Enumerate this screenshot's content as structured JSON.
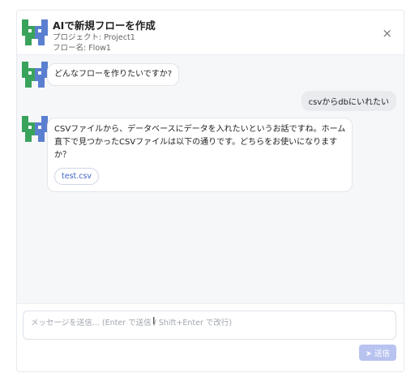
{
  "header": {
    "title": "AIで新規フローを作成",
    "project": "プロジェクト: Project1",
    "flow": "フロー名: Flow1",
    "close_label": "×"
  },
  "messages": [
    {
      "role": "assistant",
      "text": "どんなフローを作りたいですか?"
    },
    {
      "role": "user",
      "text": "csvからdbにいれたい"
    },
    {
      "role": "assistant",
      "text": "CSVファイルから、データベースにデータを入れたいというお話ですね。ホーム直下で見つかったCSVファイルは以下の通りです。どちらをお使いになりますか？",
      "file": "test.csv"
    }
  ],
  "input": {
    "placeholder": "メッセージを送信... (Enter で送信 / Shift+Enter で改行)",
    "value": ""
  },
  "send_button": {
    "label": "➤ 送信"
  },
  "cursor_glyph": "I",
  "icons": {
    "avatar": "robot-avatar-icon",
    "close": "close-icon",
    "send": "send-icon"
  },
  "colors": {
    "accent": "#3f63c8",
    "send_button": "#b9c3f0",
    "avatar_green": "#3aa35b",
    "avatar_blue": "#5b7fd0"
  }
}
